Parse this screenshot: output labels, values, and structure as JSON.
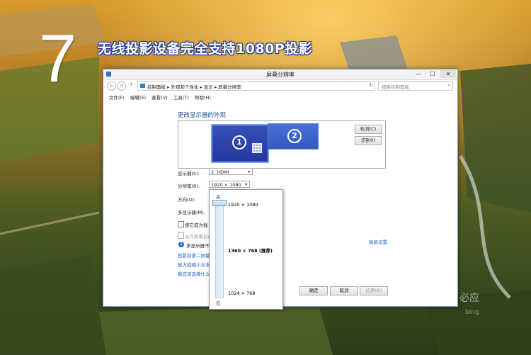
{
  "overlay": {
    "step_number": "7",
    "headline": "无线投影设备完全支持1080P投影",
    "watermark": "必应",
    "watermark_sub": "bing"
  },
  "window": {
    "title": "屏幕分辨率",
    "controls": {
      "minimize": "—",
      "maximize": "☐",
      "close": "✕"
    },
    "nav": {
      "back": "←",
      "forward": "→",
      "up": "↑"
    },
    "breadcrumb": "控制面板 ▸ 外观和个性化 ▸ 显示 ▸ 屏幕分辨率",
    "refresh": "↻",
    "search_placeholder": "搜索控制面板",
    "search_icon": "⌕",
    "menu": [
      "文件(F)",
      "编辑(E)",
      "查看(V)",
      "工具(T)",
      "帮助(H)"
    ]
  },
  "display_settings": {
    "heading": "更改显示器的外观",
    "monitor_1": "1",
    "monitor_2": "2",
    "detect_button": "检测(C)",
    "identify_button": "识别(I)",
    "display_label": "显示器(S):",
    "display_value": "2. HDMI",
    "resolution_label": "分辨率(R):",
    "resolution_value": "1920 × 1080",
    "orientation_label": "方向(O):",
    "multi_display_label": "多显示器(M):",
    "checkbox_main": "使它成为我",
    "checkbox_taskbar": "允许屏幕自动",
    "info_text": "多显示器不",
    "link_project": "投影到第二屏幕",
    "link_text_size": "放大或缩小文本",
    "link_which": "我应该选择什么",
    "advanced_link": "高级设置",
    "ok_button": "确定",
    "cancel_button": "取消",
    "apply_button": "应用(A)"
  },
  "resolution_dropdown": {
    "high_label": "高",
    "low_label": "低",
    "options": [
      "1920 × 1080",
      "1360 × 768 (推荐)",
      "1024 × 768"
    ],
    "selected": "1920 × 1080"
  },
  "colors": {
    "accent_blue": "#1e4f9c",
    "link_blue": "#1a5fbf",
    "monitor_blue": "#2f47b0"
  }
}
